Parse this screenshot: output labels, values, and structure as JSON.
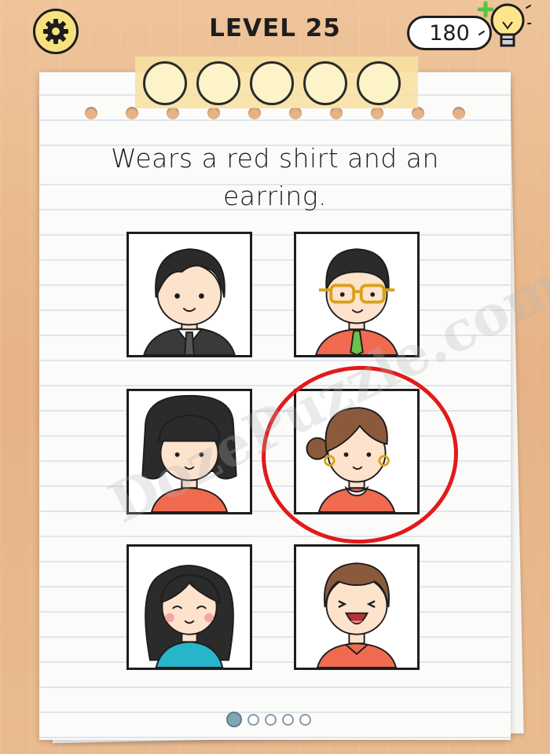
{
  "header": {
    "level_title": "LEVEL 25",
    "hint_count": "180",
    "settings_icon": "gear-icon",
    "hint_icon": "lightbulb-plus-icon"
  },
  "answer_slots": {
    "count": 5
  },
  "question": {
    "line1": "Wears a red shirt and an",
    "line2": "earring."
  },
  "options": [
    {
      "id": "man-suit",
      "shirt_color": "#3a3a3a"
    },
    {
      "id": "man-glasses",
      "shirt_color": "#f06a4f"
    },
    {
      "id": "girl-bangs",
      "shirt_color": "#f06a4f"
    },
    {
      "id": "woman-earring",
      "shirt_color": "#f06a4f",
      "selected": true
    },
    {
      "id": "woman-long-hair",
      "shirt_color": "#27b5c9"
    },
    {
      "id": "boy-laughing",
      "shirt_color": "#f06a4f"
    }
  ],
  "highlight_color": "#e21a1a",
  "watermark": "DozePuzzle.com",
  "pagination": {
    "pages": 5,
    "current": 1
  }
}
